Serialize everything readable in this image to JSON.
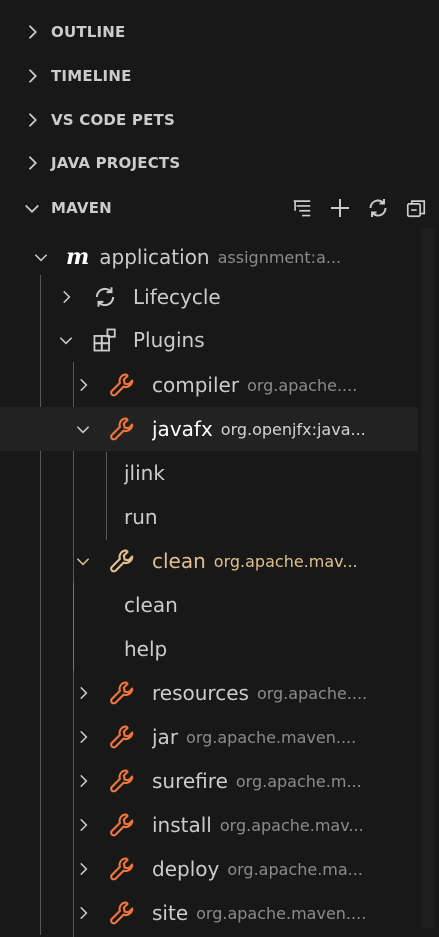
{
  "sections": [
    {
      "label": "OUTLINE",
      "expanded": false
    },
    {
      "label": "TIMELINE",
      "expanded": false
    },
    {
      "label": "VS CODE PETS",
      "expanded": false
    },
    {
      "label": "JAVA PROJECTS",
      "expanded": false
    },
    {
      "label": "MAVEN",
      "expanded": true
    }
  ],
  "maven_actions": [
    "list-view-icon",
    "add-icon",
    "refresh-icon",
    "collapse-all-icon"
  ],
  "tree": {
    "project": {
      "label": "application",
      "description": "assignment:a..."
    },
    "lifecycle": {
      "label": "Lifecycle"
    },
    "plugins": {
      "label": "Plugins"
    },
    "plugin_list": [
      {
        "label": "compiler",
        "description": "org.apache...."
      },
      {
        "label": "javafx",
        "description": "org.openjfx:java..."
      },
      {
        "label": "jlink"
      },
      {
        "label": "run"
      },
      {
        "label": "clean",
        "description": "org.apache.mav..."
      },
      {
        "label": "clean"
      },
      {
        "label": "help"
      },
      {
        "label": "resources",
        "description": "org.apache...."
      },
      {
        "label": "jar",
        "description": "org.apache.maven...."
      },
      {
        "label": "surefire",
        "description": "org.apache.m..."
      },
      {
        "label": "install",
        "description": "org.apache.mav..."
      },
      {
        "label": "deploy",
        "description": "org.apache.ma..."
      },
      {
        "label": "site",
        "description": "org.apache.maven...."
      }
    ]
  },
  "colors": {
    "background": "#181818",
    "text": "#cccccc",
    "plugin_icon": "#f0763b",
    "highlight_yellow": "#e2c08d",
    "description": "#8b8b8b"
  }
}
